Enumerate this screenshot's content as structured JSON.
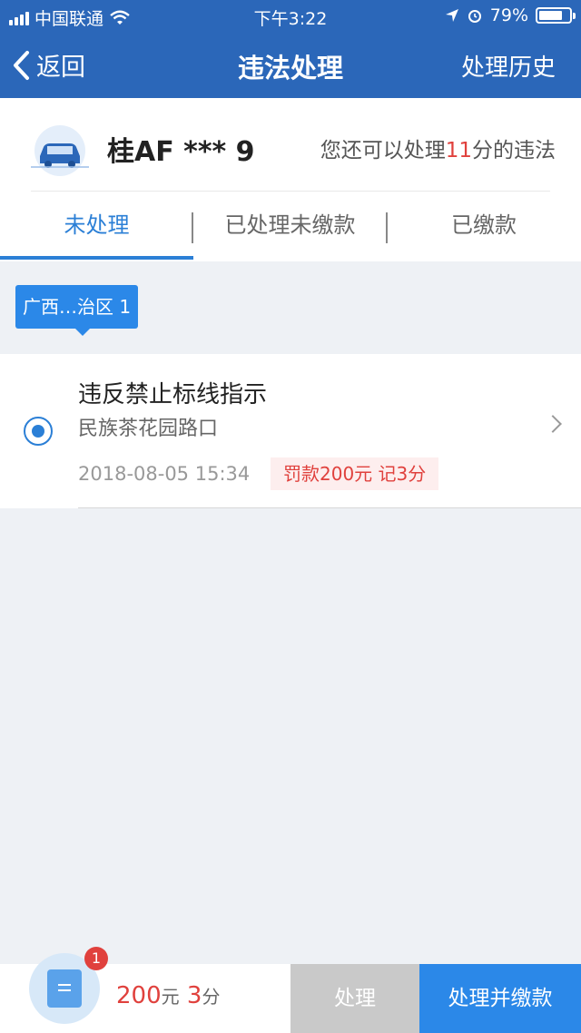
{
  "status_bar": {
    "carrier": "中国联通",
    "time": "下午3:22",
    "battery": "79%",
    "battery_level": 0.79
  },
  "nav": {
    "back_label": "返回",
    "title": "违法处理",
    "history_label": "处理历史"
  },
  "vehicle": {
    "plate": "桂AF *** 9",
    "points_prefix": "您还可以处理",
    "points_value": "11",
    "points_suffix": "分的违法"
  },
  "tabs": [
    {
      "label": "未处理",
      "active": true
    },
    {
      "label": "已处理未缴款",
      "active": false
    },
    {
      "label": "已缴款",
      "active": false
    }
  ],
  "region_badge": "广西…治区 1",
  "violations": [
    {
      "title": "违反禁止标线指示",
      "location": "民族茶花园路口",
      "time": "2018-08-05 15:34",
      "fine": "罚款200元  记3分",
      "selected": true
    }
  ],
  "bottom_bar": {
    "cart_count": "1",
    "amount": "200",
    "amount_unit": "元",
    "points": "3",
    "points_unit": "分",
    "process_label": "处理",
    "pay_label": "处理并缴款"
  },
  "colors": {
    "primary": "#2b67b9",
    "accent": "#2b7fd6",
    "danger": "#e0413d"
  }
}
